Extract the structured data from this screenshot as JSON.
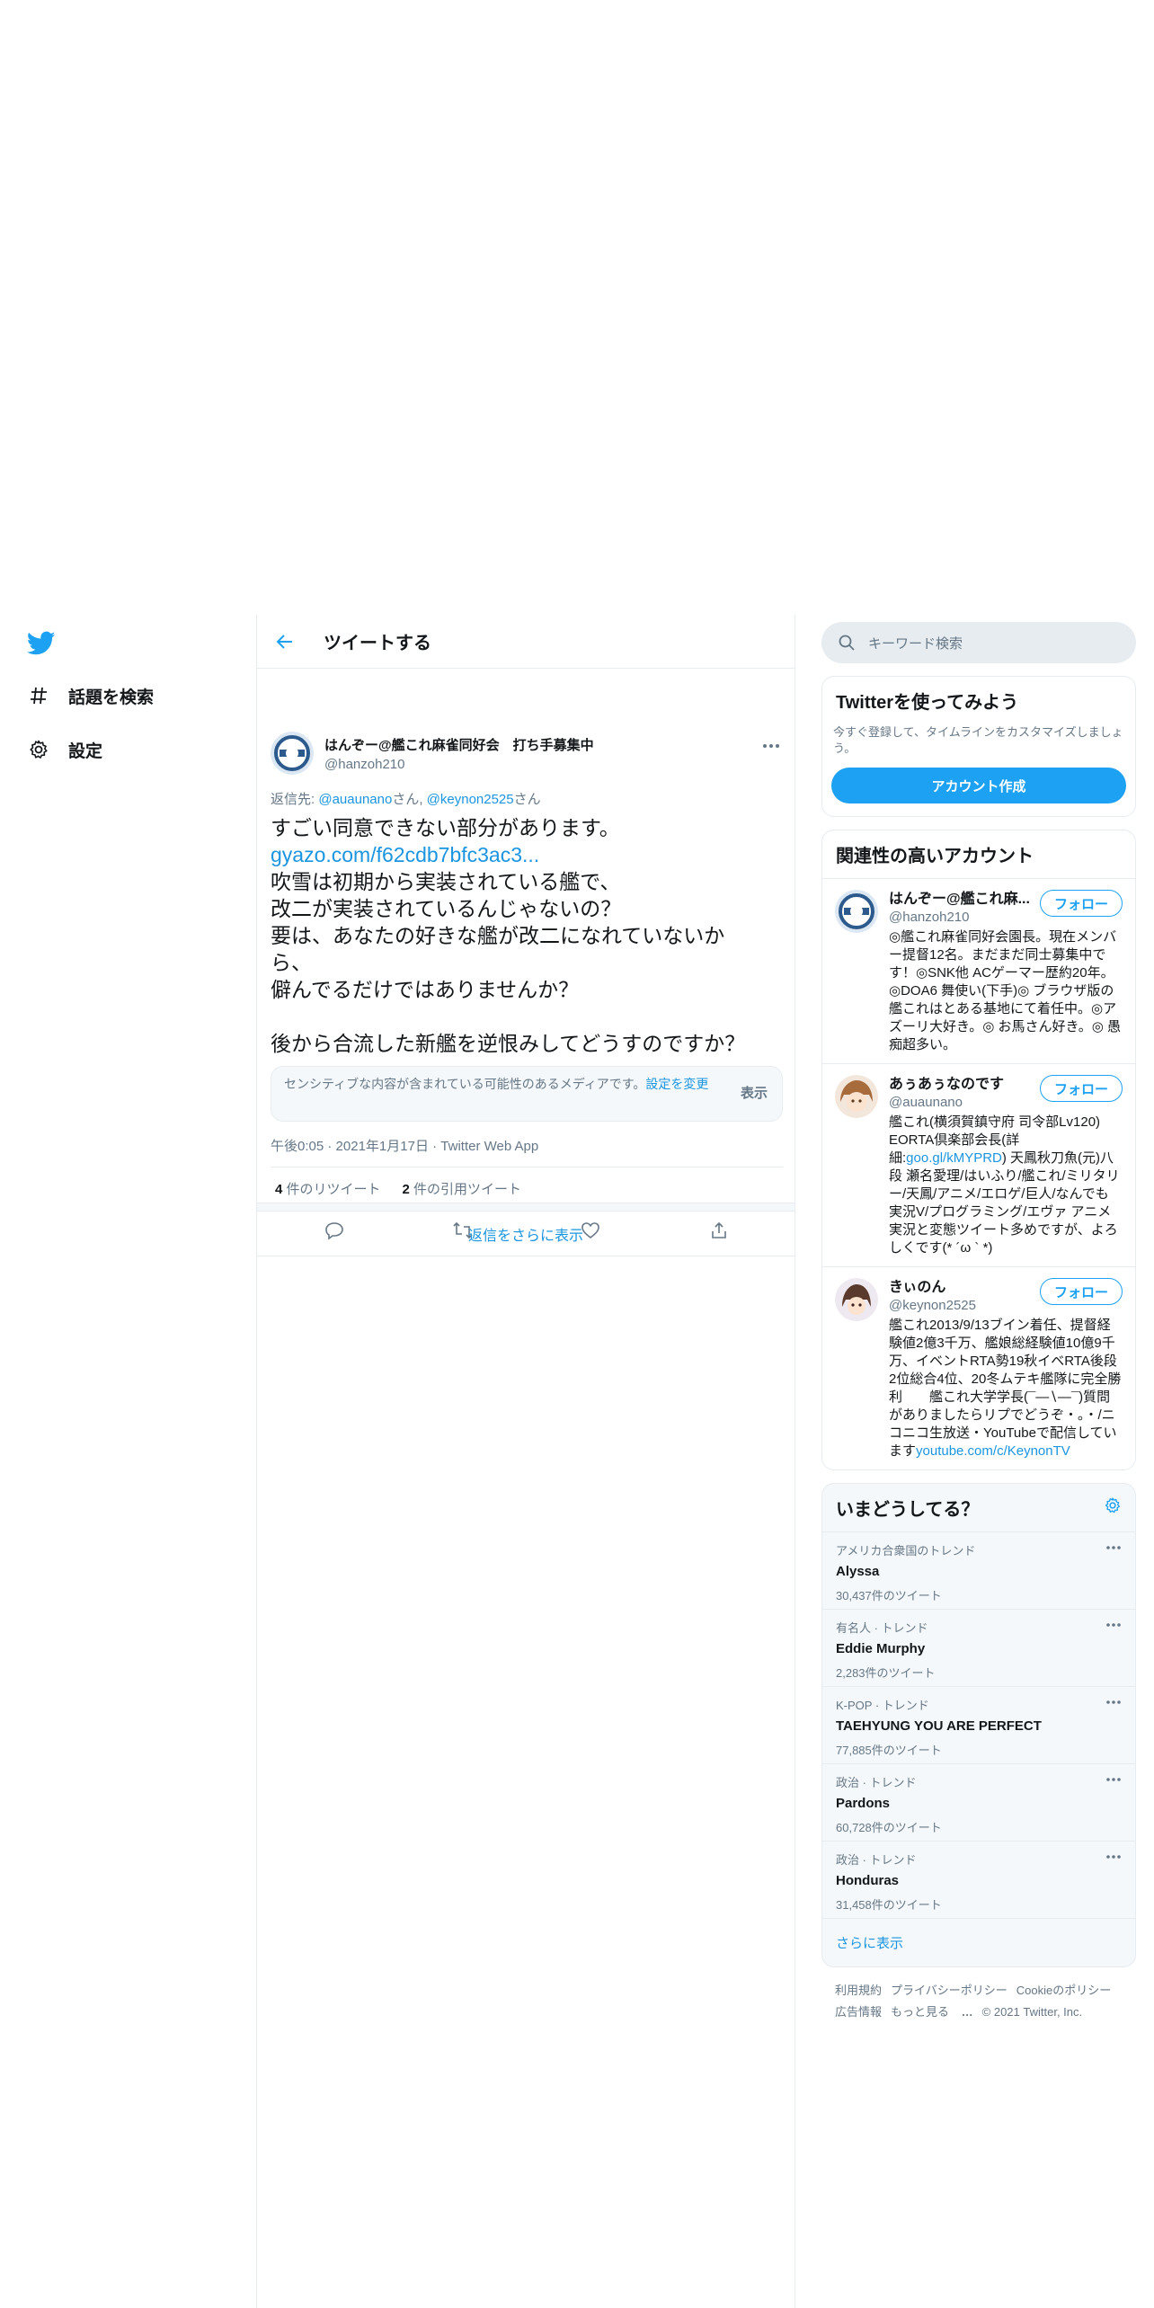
{
  "nav": {
    "items": [
      {
        "label": "話題を検索",
        "icon": "hashtag-icon"
      },
      {
        "label": "設定",
        "icon": "gear-icon"
      }
    ]
  },
  "header": {
    "title": "ツイートする"
  },
  "tweet": {
    "author_name": "はんぞー@艦これ麻雀同好会　打ち手募集中",
    "author_handle": "@hanzoh210",
    "reply_prefix": "返信先: ",
    "reply_user1": "@auaunano",
    "reply_san1": "さん, ",
    "reply_user2": "@keynon2525",
    "reply_san2": "さん",
    "text_line1": "すごい同意できない部分があります。",
    "link": "gyazo.com/f62cdb7bfc3ac3...",
    "text_rest": "吹雪は初期から実装されている艦で、\n改二が実装されているんじゃないの？\n要は、あなたの好きな艦が改二になれていないか\nら、\n僻んでるだけではありませんか？\n\n後から合流した新艦を逆恨みしてどうすのですか？",
    "sensitive_notice": "センシティブな内容が含まれている可能性のあるメディアです。",
    "sensitive_settings": "設定を変更",
    "sensitive_show": "表示",
    "time": "午後0:05",
    "date": "2021年1月17日",
    "client": "Twitter Web App",
    "retweet_count": "4",
    "retweet_label": " 件のリツイート",
    "quote_count": "2",
    "quote_label": " 件の引用ツイート",
    "show_more_replies": "返信をさらに表示"
  },
  "search": {
    "placeholder": "キーワード検索"
  },
  "try_twitter": {
    "title": "Twitterを使ってみよう",
    "desc": "今すぐ登録して、タイムラインをカスタマイズしましょう。",
    "button": "アカウント作成"
  },
  "related": {
    "title": "関連性の高いアカウント",
    "follow_label": "フォロー",
    "accounts": [
      {
        "name": "はんぞー@艦これ麻...",
        "handle": "@hanzoh210",
        "bio": "◎艦これ麻雀同好会園長。現在メンバー提督12名。まだまだ同士募集中です！◎SNK他 ACゲーマー歴約20年。◎DOA6 舞使い(下手)◎ ブラウザ版の艦これはとある基地にて着任中。◎アズーリ大好き。◎ お馬さん好き。◎ 愚痴超多い。"
      },
      {
        "name": "あぅあぅなのです",
        "handle": "@auaunano",
        "bio_before": "艦これ(横須賀鎮守府 司令部Lv120) EORTA倶楽部会長(詳細:",
        "bio_link": "goo.gl/kMYPRD",
        "bio_after": ") 天鳳秋刀魚(元)八段 瀬名愛理/はいふり/艦これ/ミリタリー/天鳳/アニメ/エロゲ/巨人/なんでも実況V/プログラミング/エヴァ アニメ実況と変態ツイート多めですが、よろしくです(* ´ω ` *)"
      },
      {
        "name": "きぃのん",
        "handle": "@keynon2525",
        "bio_before": "艦これ2013/9/13ブイン着任、提督経験値2億3千万、艦娘総経験値10億9千万、イベントRTA勢19秋イベRTA後段2位総合4位、20冬ムテキ艦隊に完全勝利　　艦これ大学学長(¯―∖―¯)質問がありましたらリプでどうぞ・。・/ニコニコ生放送・YouTubeで配信しています",
        "bio_link": "youtube.com/c/KeynonTV",
        "bio_after": ""
      }
    ]
  },
  "trends": {
    "title": "いまどうしてる？",
    "items": [
      {
        "context": "アメリカ合衆国のトレンド",
        "name": "Alyssa",
        "count": "30,437件のツイート"
      },
      {
        "context": "有名人 · トレンド",
        "name": "Eddie Murphy",
        "count": "2,283件のツイート"
      },
      {
        "context": "K-POP · トレンド",
        "name": "TAEHYUNG YOU ARE PERFECT",
        "count": "77,885件のツイート"
      },
      {
        "context": "政治 · トレンド",
        "name": "Pardons",
        "count": "60,728件のツイート"
      },
      {
        "context": "政治 · トレンド",
        "name": "Honduras",
        "count": "31,458件のツイート"
      }
    ],
    "show_more": "さらに表示"
  },
  "footer": {
    "terms": "利用規約",
    "privacy": "プライバシーポリシー",
    "cookie": "Cookieのポリシー",
    "ads": "広告情報",
    "more": "もっと見る",
    "copyright": "© 2021 Twitter, Inc."
  },
  "colors": {
    "accent": "#1da1f2",
    "link": "#1b95e0",
    "muted": "#657786",
    "border": "#e6ecf0"
  }
}
